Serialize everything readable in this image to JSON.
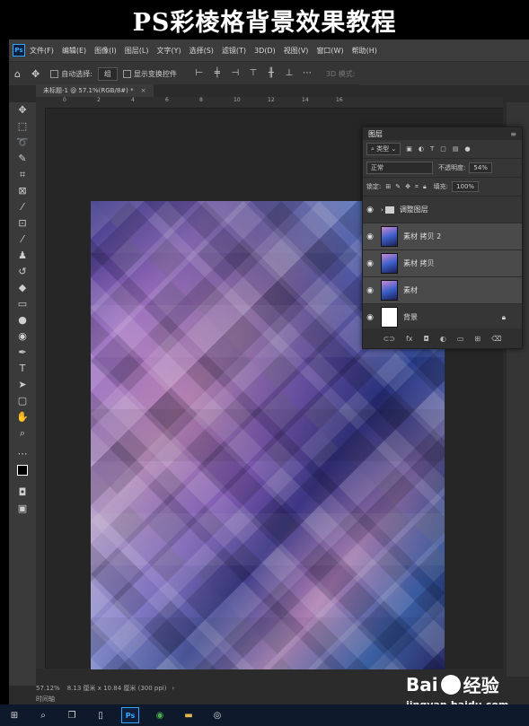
{
  "banner": {
    "title": "PS彩棱格背景效果教程"
  },
  "app": {
    "logo": "Ps",
    "menu": [
      "文件(F)",
      "编辑(E)",
      "图像(I)",
      "图层(L)",
      "文字(Y)",
      "选择(S)",
      "滤镜(T)",
      "3D(D)",
      "视图(V)",
      "窗口(W)",
      "帮助(H)"
    ],
    "options": {
      "auto_select_label": "自动选择:",
      "auto_select_value": "组",
      "show_transform_label": "显示变换控件",
      "mode_3d_label": "3D 模式:"
    },
    "tab": {
      "label": "未标题-1 @ 57.1%(RGB/8#) *",
      "close": "×"
    },
    "ruler_marks": [
      "0",
      "2",
      "4",
      "6",
      "8",
      "10",
      "12",
      "14",
      "16",
      "18",
      "20",
      "22",
      "24"
    ],
    "status": {
      "zoom": "57.12%",
      "doc_info": "8.13 厘米 x 10.84 厘米 (300 ppi)"
    },
    "timeline_label": "时间轴"
  },
  "layers_panel": {
    "title": "图层",
    "filter_kind": "类型",
    "blend_mode": "正常",
    "opacity_label": "不透明度:",
    "opacity_value": "54%",
    "lock_label": "锁定:",
    "fill_label": "填充:",
    "fill_value": "100%",
    "layers": [
      {
        "name": "调整图层",
        "kind": "group",
        "selected": false
      },
      {
        "name": "素材 拷贝 2",
        "kind": "pixel",
        "selected": true
      },
      {
        "name": "素材 拷贝",
        "kind": "pixel",
        "selected": true
      },
      {
        "name": "素材",
        "kind": "pixel",
        "selected": true
      },
      {
        "name": "背景",
        "kind": "background",
        "selected": false
      }
    ],
    "footer_icons": [
      "link-icon",
      "fx-icon",
      "mask-icon",
      "adjustment-icon",
      "group-icon",
      "new-layer-icon",
      "trash-icon"
    ]
  },
  "watermark": {
    "brand": "Bai",
    "brand2": "经验",
    "site": "jingyan.baidu.com"
  },
  "colors": {
    "accent": "#31a8ff",
    "panel": "#363636",
    "selected": "#4a4a4a"
  }
}
